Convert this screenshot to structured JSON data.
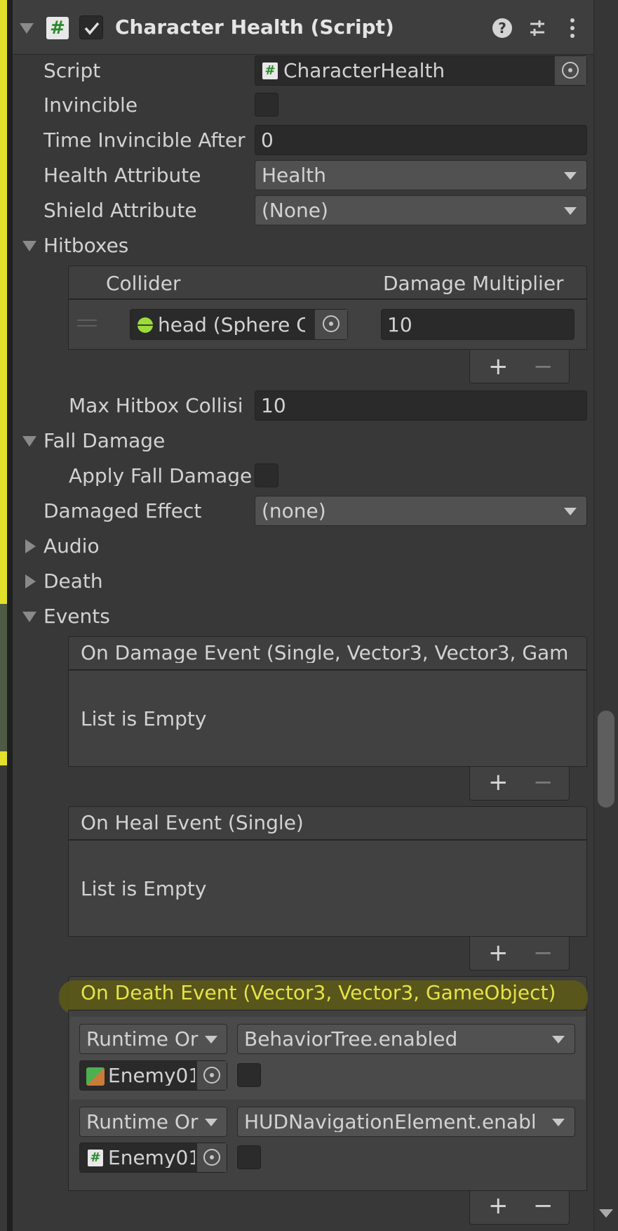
{
  "component": {
    "title": "Character Health (Script)",
    "icons": [
      "help-icon",
      "presets-icon",
      "more-icon"
    ]
  },
  "fields": {
    "script_label": "Script",
    "script_value": "CharacterHealth",
    "invincible_label": "Invincible",
    "time_invincible_label": "Time Invincible After",
    "time_invincible_value": "0",
    "health_attr_label": "Health Attribute",
    "health_attr_value": "Health",
    "shield_attr_label": "Shield Attribute",
    "shield_attr_value": "(None)",
    "max_hitbox_label": "Max Hitbox Collisi",
    "max_hitbox_value": "10",
    "apply_fall_label": "Apply Fall Damage",
    "damaged_effect_label": "Damaged Effect",
    "damaged_effect_value": "(none)"
  },
  "sections": {
    "hitboxes": "Hitboxes",
    "fall_damage": "Fall Damage",
    "audio": "Audio",
    "death": "Death",
    "events": "Events"
  },
  "hitboxes": {
    "col_collider": "Collider",
    "col_multiplier": "Damage Multiplier",
    "row": {
      "collider": "head (Sphere C",
      "multiplier": "10"
    }
  },
  "events": {
    "damage_header": "On Damage Event (Single, Vector3, Vector3, Gam",
    "heal_header": "On Heal Event (Single)",
    "death_header": "On Death Event (Vector3, Vector3, GameObject)",
    "empty_text": "List is Empty",
    "death_entries": [
      {
        "runtime": "Runtime Or",
        "function": "BehaviorTree.enabled",
        "object": "Enemy01"
      },
      {
        "runtime": "Runtime Or",
        "function": "HUDNavigationElement.enabl",
        "object": "Enemy01"
      }
    ]
  },
  "list_controls": {
    "plus": "+",
    "minus": "−"
  },
  "colors": {
    "background": "#383838",
    "field": "#2a2a2a",
    "dropdown": "#515151",
    "highlight_text": "#e6e24a",
    "highlight_band": "#5d5a14",
    "left_strip": "#e3e02b"
  }
}
